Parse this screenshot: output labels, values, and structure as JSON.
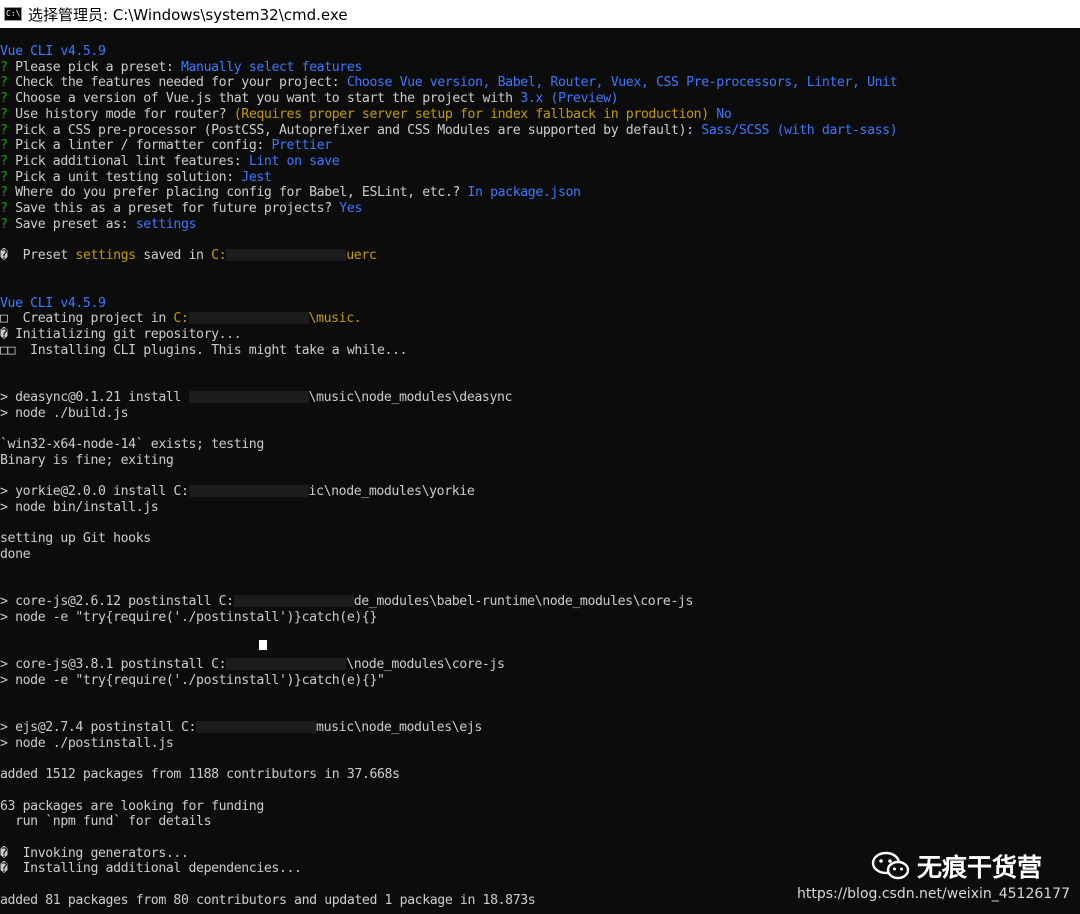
{
  "window": {
    "title": "选择管理员: C:\\Windows\\system32\\cmd.exe",
    "icon_text": "C:\\"
  },
  "lines": [
    [
      {
        "t": "Vue CLI v4.5.9",
        "c": "b"
      }
    ],
    [
      {
        "t": "? ",
        "c": "g"
      },
      {
        "t": "Please pick a preset: ",
        "c": "w"
      },
      {
        "t": "Manually select features",
        "c": "b"
      }
    ],
    [
      {
        "t": "? ",
        "c": "g"
      },
      {
        "t": "Check the features needed for your project: ",
        "c": "w"
      },
      {
        "t": "Choose Vue version, Babel, Router, Vuex, CSS Pre-processors, Linter, Unit",
        "c": "b"
      }
    ],
    [
      {
        "t": "? ",
        "c": "g"
      },
      {
        "t": "Choose a version of Vue.js that you want to start the project with ",
        "c": "w"
      },
      {
        "t": "3.x (Preview)",
        "c": "b"
      }
    ],
    [
      {
        "t": "? ",
        "c": "g"
      },
      {
        "t": "Use history mode for router? ",
        "c": "w"
      },
      {
        "t": "(Requires proper server setup for index fallback in production) ",
        "c": "y"
      },
      {
        "t": "No",
        "c": "b"
      }
    ],
    [
      {
        "t": "? ",
        "c": "g"
      },
      {
        "t": "Pick a CSS pre-processor (PostCSS, Autoprefixer and CSS Modules are supported by default): ",
        "c": "w"
      },
      {
        "t": "Sass/SCSS (with dart-sass)",
        "c": "b"
      }
    ],
    [
      {
        "t": "? ",
        "c": "g"
      },
      {
        "t": "Pick a linter / formatter config: ",
        "c": "w"
      },
      {
        "t": "Prettier",
        "c": "b"
      }
    ],
    [
      {
        "t": "? ",
        "c": "g"
      },
      {
        "t": "Pick additional lint features: ",
        "c": "w"
      },
      {
        "t": "Lint on save",
        "c": "b"
      }
    ],
    [
      {
        "t": "? ",
        "c": "g"
      },
      {
        "t": "Pick a unit testing solution: ",
        "c": "w"
      },
      {
        "t": "Jest",
        "c": "b"
      }
    ],
    [
      {
        "t": "? ",
        "c": "g"
      },
      {
        "t": "Where do you prefer placing config for Babel, ESLint, etc.? ",
        "c": "w"
      },
      {
        "t": "In package.json",
        "c": "b"
      }
    ],
    [
      {
        "t": "? ",
        "c": "g"
      },
      {
        "t": "Save this as a preset for future projects? ",
        "c": "w"
      },
      {
        "t": "Yes",
        "c": "b"
      }
    ],
    [
      {
        "t": "? ",
        "c": "g"
      },
      {
        "t": "Save preset as: ",
        "c": "w"
      },
      {
        "t": "settings",
        "c": "b"
      }
    ],
    [],
    [
      {
        "t": "�  Preset ",
        "c": "w"
      },
      {
        "t": "settings",
        "c": "y"
      },
      {
        "t": " saved in ",
        "c": "w"
      },
      {
        "t": "C:",
        "c": "y"
      },
      {
        "t": "",
        "c": "redact"
      },
      {
        "t": "uerc",
        "c": "y"
      }
    ],
    [],
    [],
    [
      {
        "t": "Vue CLI v4.5.9",
        "c": "b"
      }
    ],
    [
      {
        "t": "□  Creating project in ",
        "c": "w"
      },
      {
        "t": "C:",
        "c": "y"
      },
      {
        "t": "",
        "c": "redact"
      },
      {
        "t": "\\music.",
        "c": "y"
      }
    ],
    [
      {
        "t": "� Initializing git repository...",
        "c": "w"
      }
    ],
    [
      {
        "t": "□□  Installing CLI plugins. This might take a while...",
        "c": "w"
      }
    ],
    [],
    [],
    [
      {
        "t": "> deasync@0.1.21 install ",
        "c": "w"
      },
      {
        "t": "",
        "c": "redact"
      },
      {
        "t": "\\music\\node_modules\\deasync",
        "c": "w"
      }
    ],
    [
      {
        "t": "> node ./build.js",
        "c": "w"
      }
    ],
    [],
    [
      {
        "t": "`win32-x64-node-14` exists; testing",
        "c": "w"
      }
    ],
    [
      {
        "t": "Binary is fine; exiting",
        "c": "w"
      }
    ],
    [],
    [
      {
        "t": "> yorkie@2.0.0 install C:",
        "c": "w"
      },
      {
        "t": "",
        "c": "redact"
      },
      {
        "t": "ic\\node_modules\\yorkie",
        "c": "w"
      }
    ],
    [
      {
        "t": "> node bin/install.js",
        "c": "w"
      }
    ],
    [],
    [
      {
        "t": "setting up Git hooks",
        "c": "w"
      }
    ],
    [
      {
        "t": "done",
        "c": "w"
      }
    ],
    [],
    [],
    [
      {
        "t": "> core-js@2.6.12 postinstall C:",
        "c": "w"
      },
      {
        "t": "",
        "c": "redact"
      },
      {
        "t": "de_modules\\babel-runtime\\node_modules\\core-js",
        "c": "w"
      }
    ],
    [
      {
        "t": "> node -e \"try{require('./postinstall')}catch(e){}",
        "c": "w"
      }
    ],
    [],
    [],
    [
      {
        "t": "> core-js@3.8.1 postinstall C:",
        "c": "w"
      },
      {
        "t": "",
        "c": "redact"
      },
      {
        "t": "\\node_modules\\core-js",
        "c": "w"
      }
    ],
    [
      {
        "t": "> node -e \"try{require('./postinstall')}catch(e){}\"",
        "c": "w"
      }
    ],
    [],
    [],
    [
      {
        "t": "> ejs@2.7.4 postinstall C:",
        "c": "w"
      },
      {
        "t": "",
        "c": "redact"
      },
      {
        "t": "music\\node_modules\\ejs",
        "c": "w"
      }
    ],
    [
      {
        "t": "> node ./postinstall.js",
        "c": "w"
      }
    ],
    [],
    [
      {
        "t": "added 1512 packages from 1188 contributors in 37.668s",
        "c": "w"
      }
    ],
    [],
    [
      {
        "t": "63 packages are looking for funding",
        "c": "w"
      }
    ],
    [
      {
        "t": "  run `npm fund` for details",
        "c": "w"
      }
    ],
    [],
    [
      {
        "t": "�  Invoking generators...",
        "c": "w"
      }
    ],
    [
      {
        "t": "�  Installing additional dependencies...",
        "c": "w"
      }
    ],
    [],
    [
      {
        "t": "added 81 packages from 80 contributors and updated 1 package in 18.873s",
        "c": "w"
      }
    ]
  ],
  "watermark": {
    "text": "无痕干货营",
    "icon": "wechat-icon",
    "url": "https://blog.csdn.net/weixin_45126177"
  },
  "colors": {
    "background": "#0c0c0c",
    "text": "#cccccc",
    "green": "#13a10e",
    "blue": "#3b78ff",
    "yellow": "#c19c00"
  }
}
